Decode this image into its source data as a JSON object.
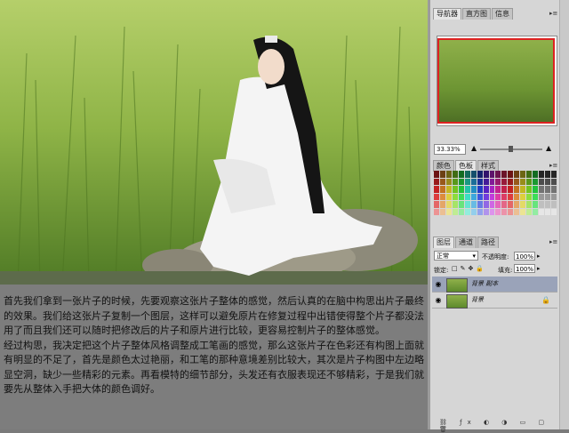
{
  "caption": {
    "paragraph1": "首先我们拿到一张片子的时候，先要观察这张片子整体的感觉，然后认真的在脑中构思出片子最终的效果。我们给这张片子复制一个图层，这样可以避免原片在修复过程中出错使得整个片子都没法用了而且我们还可以随时把修改后的片子和原片进行比较，更容易控制片子的整体感觉。",
    "paragraph2": "经过构思，我决定把这个片子整体风格调整成工笔画的感觉，那么这张片子在色彩还有构图上面就有明显的不足了，首先是颜色太过艳丽，和工笔的那种意境差别比较大，其次是片子构图中左边略显空洞，缺少一些精彩的元素。再看模特的细节部分，头发还有衣服表现还不够精彩，于是我们就要先从整体入手把大体的颜色调好。"
  },
  "navigator": {
    "tabs": [
      "导航器",
      "直方图",
      "信息"
    ],
    "zoom": "33.33%"
  },
  "color_panel": {
    "tabs": [
      "颜色",
      "色板",
      "样式"
    ]
  },
  "layers_panel": {
    "tabs": [
      "图层",
      "通道",
      "路径"
    ],
    "blend_mode": "正常",
    "opacity_label": "不透明度:",
    "opacity_value": "100%",
    "lock_label": "锁定:",
    "fill_label": "填充:",
    "fill_value": "100%",
    "layers": [
      {
        "name": "背景 副本",
        "selected": true
      },
      {
        "name": "背景",
        "selected": false,
        "locked": true
      }
    ]
  },
  "icons": {
    "eye": "eye-icon",
    "lock": "lock-icon",
    "panel_menu": "panel-menu-icon",
    "zoom_out": "zoom-out-icon",
    "zoom_in": "zoom-in-icon"
  },
  "colors": {
    "selection": "#9aa3b9",
    "nav_view_box": "#dd2222"
  }
}
